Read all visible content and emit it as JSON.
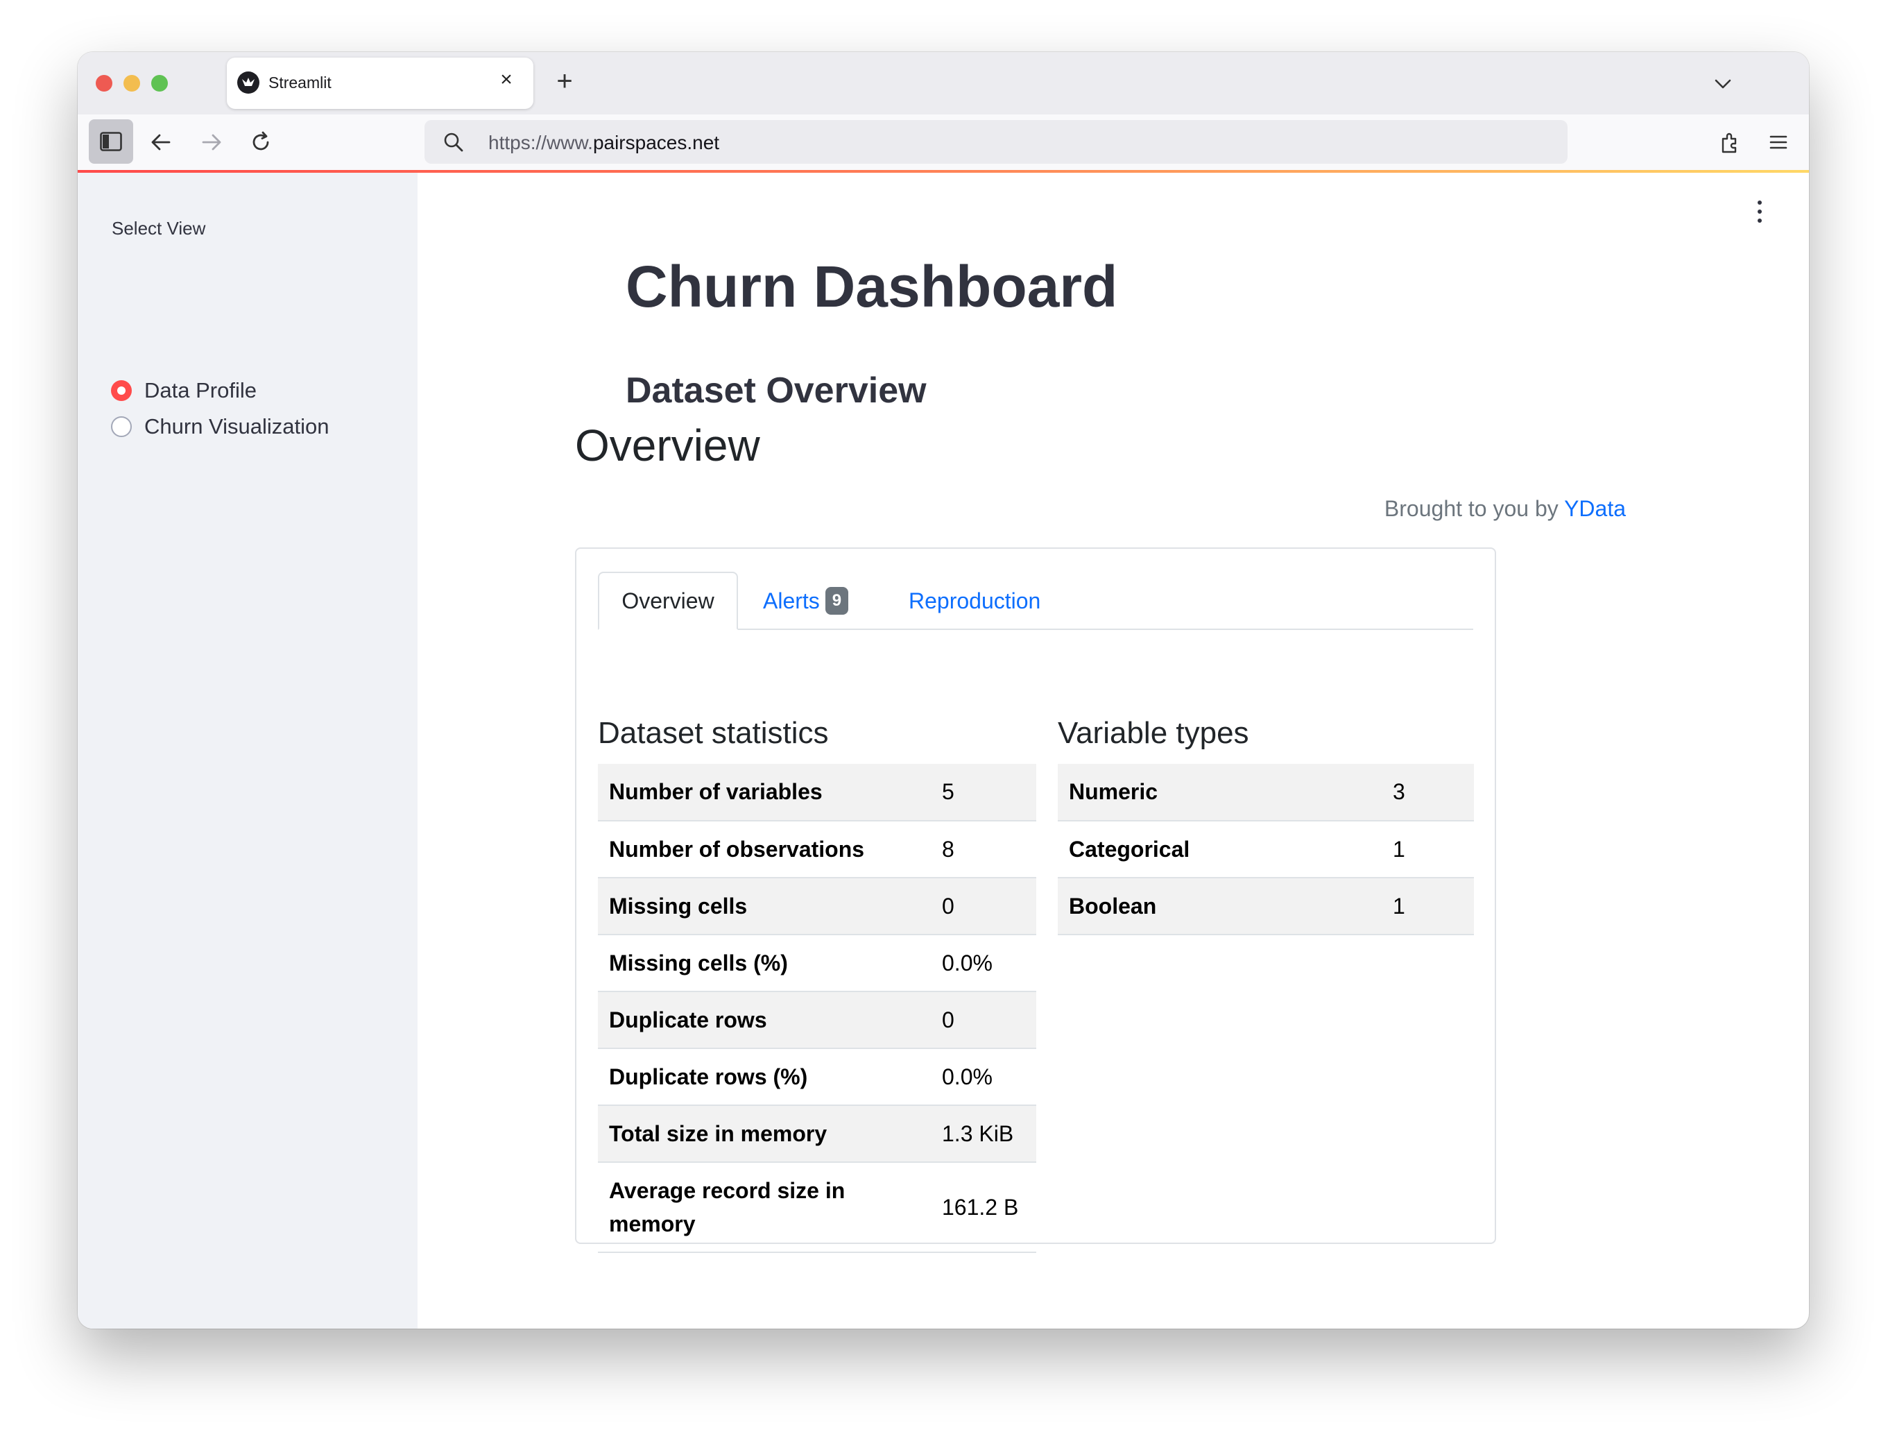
{
  "browser": {
    "tab_title": "Streamlit",
    "url_prefix": "https://www.",
    "url_host": "pairspaces.net",
    "accent_colors": {
      "loading_bar": "#ff4b4b",
      "radio_selected": "#ff4b4b",
      "link": "#0d6efd"
    }
  },
  "sidebar": {
    "select_label": "Select View",
    "options": [
      {
        "label": "Data Profile",
        "selected": true
      },
      {
        "label": "Churn Visualization",
        "selected": false
      }
    ]
  },
  "main": {
    "title": "Churn Dashboard",
    "subheader": "Dataset Overview"
  },
  "report": {
    "title": "Overview",
    "brought_by_text": "Brought to you by",
    "brought_by_link": "YData",
    "tabs": [
      {
        "label": "Overview",
        "active": true
      },
      {
        "label": "Alerts",
        "badge": "9",
        "active": false
      },
      {
        "label": "Reproduction",
        "active": false
      }
    ],
    "dataset_statistics": {
      "title": "Dataset statistics",
      "rows": [
        {
          "key": "Number of variables",
          "value": "5"
        },
        {
          "key": "Number of observations",
          "value": "8"
        },
        {
          "key": "Missing cells",
          "value": "0"
        },
        {
          "key": "Missing cells (%)",
          "value": "0.0%"
        },
        {
          "key": "Duplicate rows",
          "value": "0"
        },
        {
          "key": "Duplicate rows (%)",
          "value": "0.0%"
        },
        {
          "key": "Total size in memory",
          "value": "1.3 KiB"
        },
        {
          "key": "Average record size in memory",
          "value": "161.2 B"
        }
      ]
    },
    "variable_types": {
      "title": "Variable types",
      "rows": [
        {
          "key": "Numeric",
          "value": "3"
        },
        {
          "key": "Categorical",
          "value": "1"
        },
        {
          "key": "Boolean",
          "value": "1"
        }
      ]
    }
  }
}
